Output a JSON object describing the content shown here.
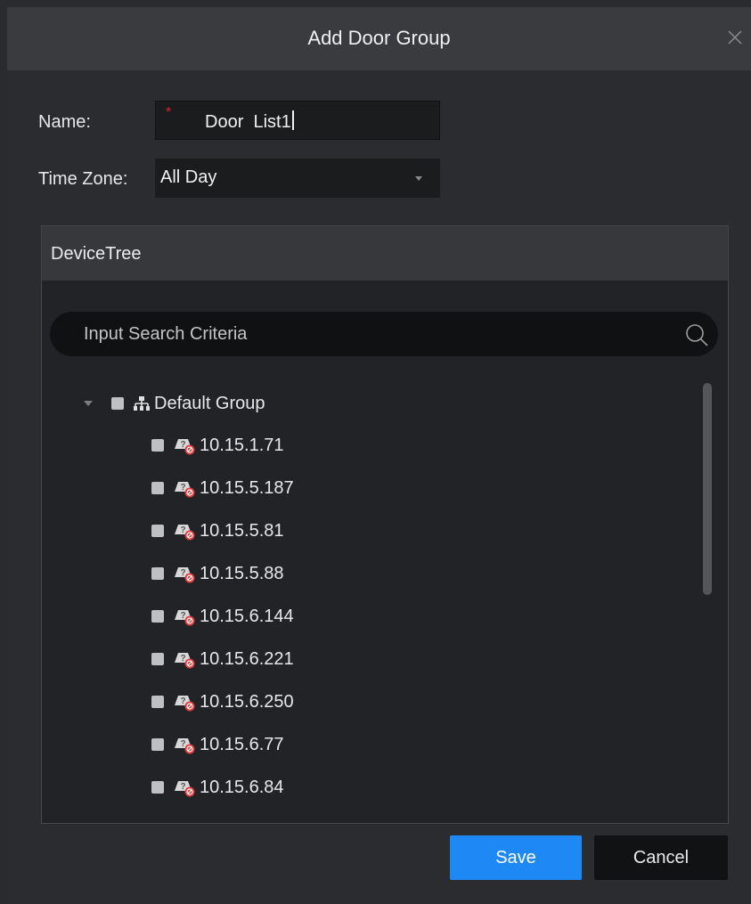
{
  "dialog": {
    "title": "Add Door Group",
    "close_icon": "close-icon"
  },
  "form": {
    "name_label": "Name:",
    "required_mark": "*",
    "name_value": "Door  List1",
    "timezone_label": "Time Zone:",
    "timezone_value": "All Day"
  },
  "device_tree": {
    "title": "DeviceTree",
    "search_placeholder": "Input Search Criteria",
    "group": {
      "label": "Default Group",
      "expanded": true,
      "checked": false,
      "icon": "network-group-icon"
    },
    "devices": [
      {
        "label": "10.15.1.71",
        "icon": "offline-device-icon",
        "checked": false
      },
      {
        "label": "10.15.5.187",
        "icon": "offline-device-icon",
        "checked": false
      },
      {
        "label": "10.15.5.81",
        "icon": "offline-device-icon",
        "checked": false
      },
      {
        "label": "10.15.5.88",
        "icon": "offline-device-icon",
        "checked": false
      },
      {
        "label": "10.15.6.144",
        "icon": "offline-device-icon",
        "checked": false
      },
      {
        "label": "10.15.6.221",
        "icon": "offline-device-icon",
        "checked": false
      },
      {
        "label": "10.15.6.250",
        "icon": "offline-device-icon",
        "checked": false
      },
      {
        "label": "10.15.6.77",
        "icon": "offline-device-icon",
        "checked": false
      },
      {
        "label": "10.15.6.84",
        "icon": "offline-device-icon",
        "checked": false
      }
    ]
  },
  "buttons": {
    "save": "Save",
    "cancel": "Cancel"
  },
  "colors": {
    "accent": "#1e88f5",
    "required": "#e02020",
    "background": "#2b2c30"
  }
}
